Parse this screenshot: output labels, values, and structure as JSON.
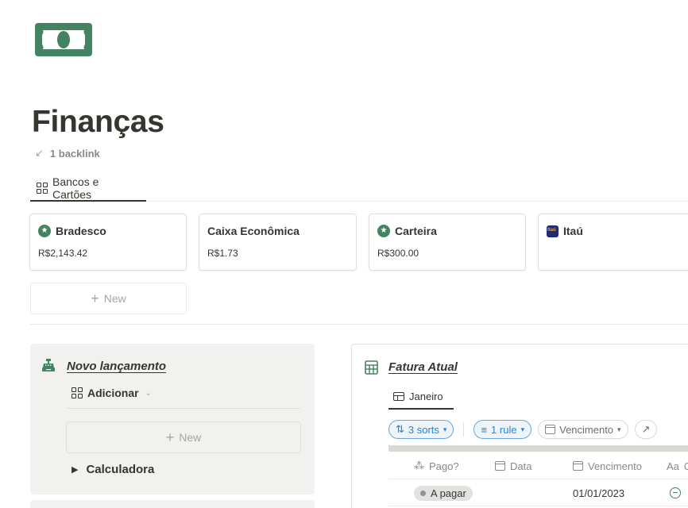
{
  "page": {
    "title": "Finanças",
    "icon": "money-bill-icon",
    "backlink_label": "1 backlink"
  },
  "view": {
    "tab_label": "Bancos e Cartões"
  },
  "cards": [
    {
      "title": "Bradesco",
      "value": "R$2,143.42",
      "icon": "star-icon"
    },
    {
      "title": "Caixa Econômica",
      "value": "R$1.73",
      "icon": ""
    },
    {
      "title": "Carteira",
      "value": "R$300.00",
      "icon": "star-icon"
    },
    {
      "title": "Itaú",
      "value": "",
      "icon": "itau-logo-icon"
    }
  ],
  "new_card_label": "New",
  "callout": {
    "title": "Novo lançamento",
    "add_label": "Adicionar",
    "new_label": "New",
    "toggle_label": "Calculadora"
  },
  "database": {
    "title": "Fatura Atual",
    "tab_label": "Janeiro",
    "sorts_label": "3 sorts",
    "rule_label": "1 rule",
    "vencimento_filter": "Vencimento",
    "columns": [
      "Pago?",
      "Data",
      "Vencimento",
      "C"
    ],
    "rows": [
      {
        "status": "A pagar",
        "data": "",
        "vencimento": "01/01/2023"
      }
    ]
  },
  "colors": {
    "text": "#37352f",
    "muted": "#8a8985",
    "accent_green": "#448361",
    "accent_blue": "#2383e2",
    "callout_bg": "#f1f1ef"
  }
}
